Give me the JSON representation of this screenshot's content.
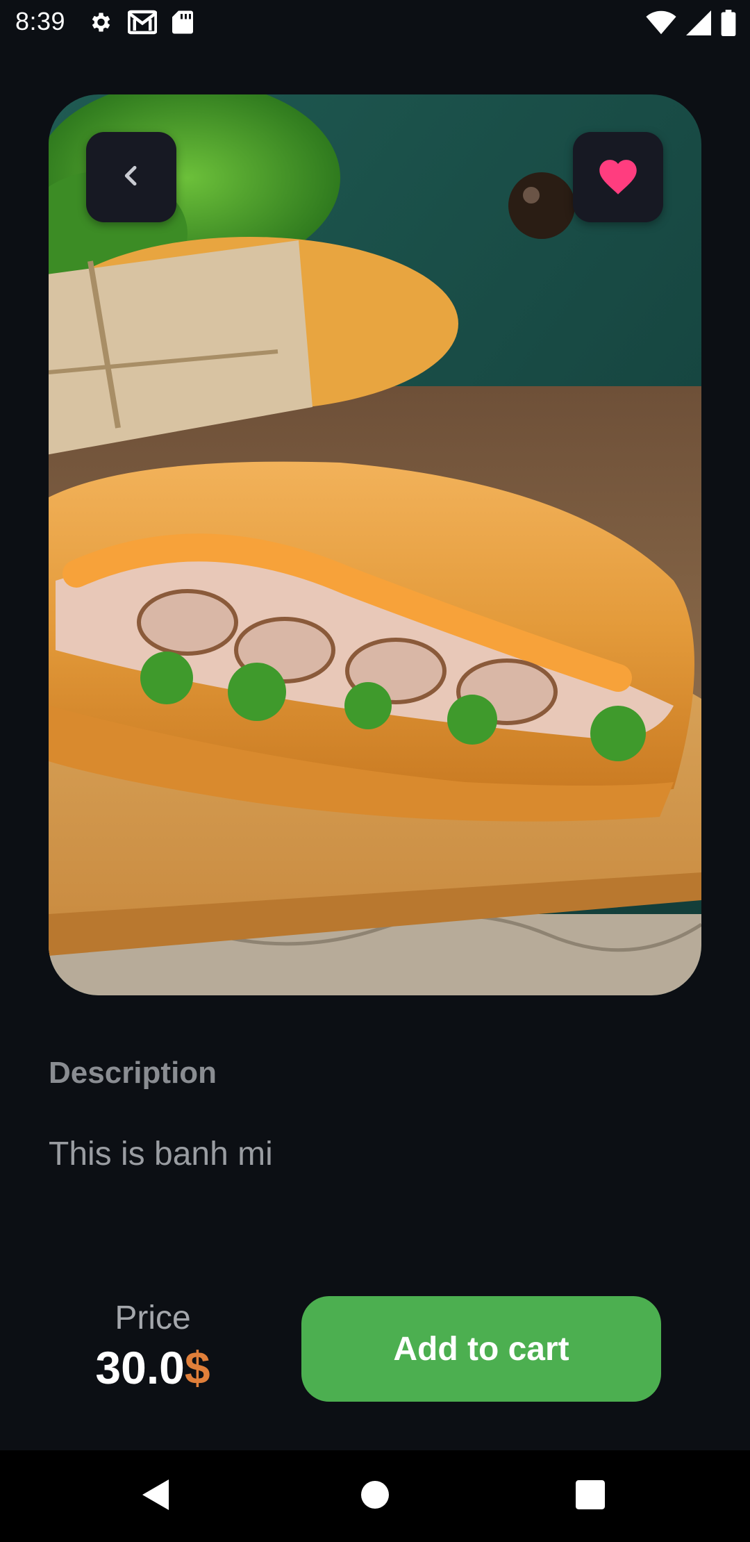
{
  "status_bar": {
    "time": "8:39",
    "left_icons": [
      "settings-icon",
      "gmail-icon",
      "sd-card-icon"
    ],
    "right_icons": [
      "wifi-icon",
      "signal-icon",
      "battery-icon"
    ]
  },
  "hero": {
    "image": "banh-mi-photo",
    "back_icon": "chevron-left-icon",
    "favorite_icon": "heart-icon",
    "favorite_color": "#ff3d7f"
  },
  "description": {
    "title": "Description",
    "text": "This is banh mi"
  },
  "price": {
    "label": "Price",
    "amount": "30.0",
    "currency": "$",
    "currency_color": "#e07f3a"
  },
  "cart": {
    "button_label": "Add to cart",
    "button_color": "#4caf50"
  },
  "nav_bar": {
    "icons": [
      "back-triangle-icon",
      "home-circle-icon",
      "recents-square-icon"
    ]
  }
}
